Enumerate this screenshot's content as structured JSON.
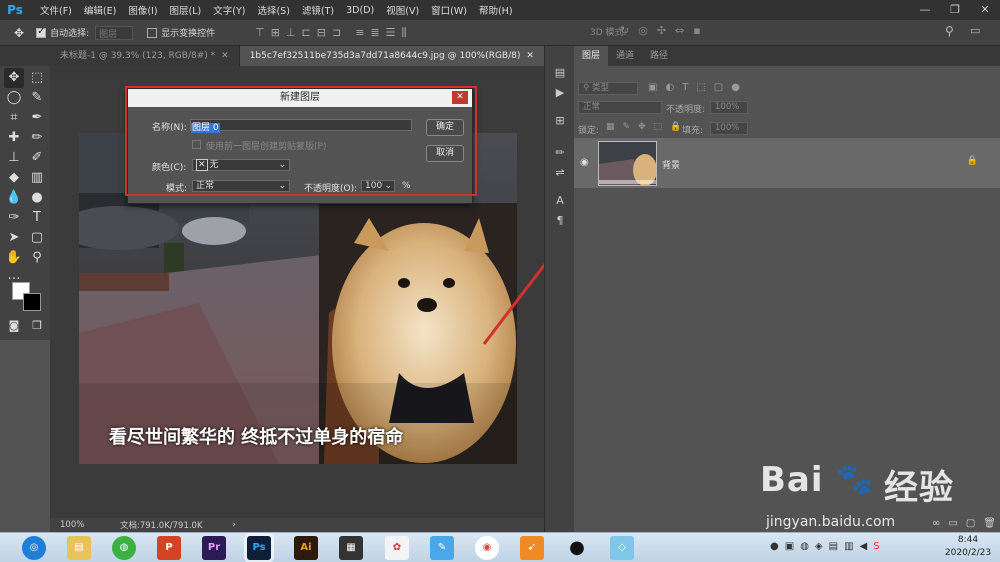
{
  "app": {
    "logo": "Ps"
  },
  "menubar": {
    "items": [
      "文件(F)",
      "编辑(E)",
      "图像(I)",
      "图层(L)",
      "文字(Y)",
      "选择(S)",
      "滤镜(T)",
      "3D(D)",
      "视图(V)",
      "窗口(W)",
      "帮助(H)"
    ],
    "window_controls": [
      "—",
      "❐",
      "✕"
    ]
  },
  "options_bar": {
    "auto_select_label": "自动选择:",
    "auto_select_value": "图层",
    "show_transform_label": "显示变换控件",
    "mode_3d_label": "3D 模式:"
  },
  "tabs": [
    {
      "label": "未标题-1 @ 39.3% (123, RGB/8#) *",
      "active": false
    },
    {
      "label": "1b5c7ef32511be735d3a7dd71a8644c9.jpg @ 100%(RGB/8)",
      "active": true
    }
  ],
  "image": {
    "caption": "看尽世间繁华的 终抵不过单身的宿命"
  },
  "dialog": {
    "title": "新建图层",
    "name_label": "名称(N):",
    "name_value": "图层 0",
    "clip_label": "使用前一图层创建剪贴蒙版(P)",
    "color_label": "颜色(C):",
    "color_value": "无",
    "mode_label": "模式:",
    "mode_value": "正常",
    "opacity_label": "不透明度(O):",
    "opacity_value": "100",
    "opacity_unit": "%",
    "ok_label": "确定",
    "cancel_label": "取消"
  },
  "statusbar": {
    "zoom": "100%",
    "doc_info": "文档:791.0K/791.0K"
  },
  "layers_panel": {
    "tabs": [
      "图层",
      "通道",
      "路径"
    ],
    "filter_placeholder": "类型",
    "blend_mode": "正常",
    "opacity_label": "不透明度:",
    "opacity_value": "100%",
    "lock_label": "锁定:",
    "fill_label": "填充:",
    "fill_value": "100%",
    "layer_name": "背景"
  },
  "taskbar": {
    "time": "8:44",
    "date": "2020/2/23"
  },
  "watermark": {
    "line1": "Bai",
    "line1b": "经验",
    "line2": "jingyan.baidu.com"
  },
  "colors": {
    "accent": "#31a8ff",
    "annotation_red": "#d0312d",
    "selection_blue": "#3875d7"
  }
}
